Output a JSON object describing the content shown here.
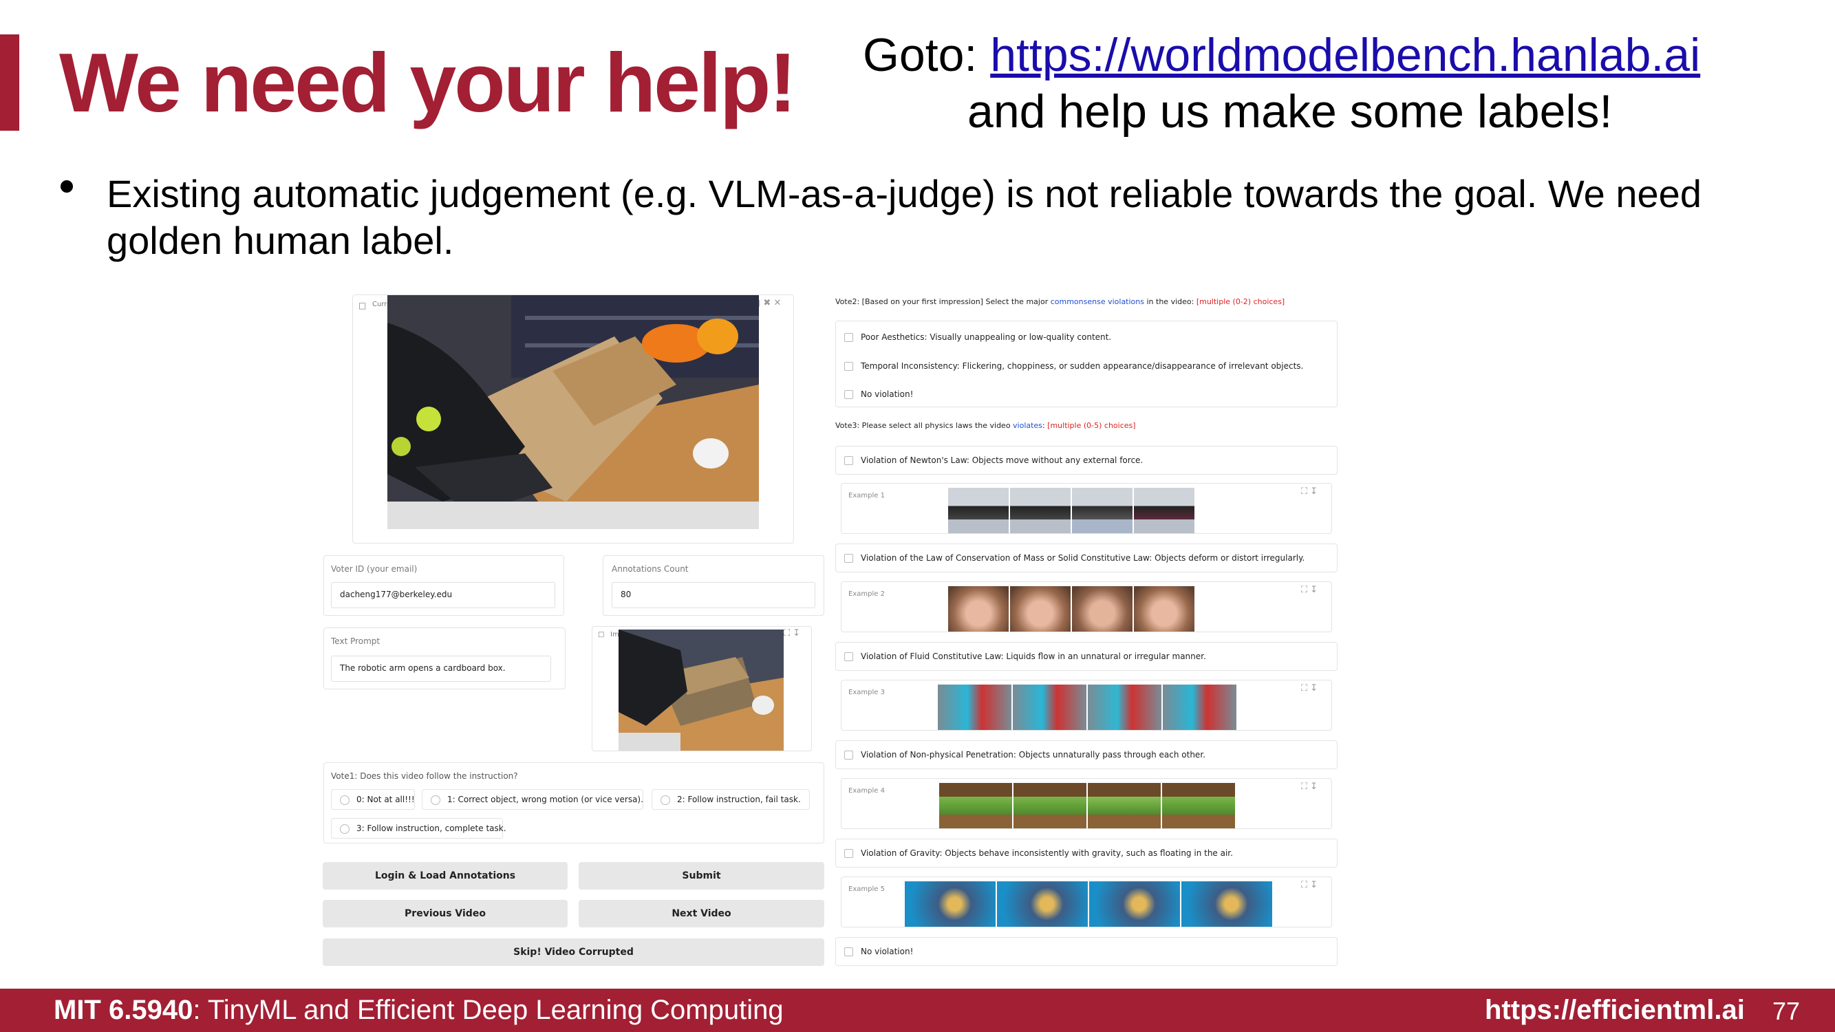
{
  "slide": {
    "title": "We need your help!",
    "goto_prefix": "Goto: ",
    "goto_url": "https://worldmodelbench.hanlab.ai",
    "goto_line2": "and help us make some labels!",
    "bullet": "Existing automatic judgement (e.g. VLM-as-a-judge) is not reliable towards the goal. We need golden human label.",
    "footer_course": "MIT 6.5940",
    "footer_title": ": TinyML and Efficient Deep Learning Computing",
    "footer_url": "https://efficientml.ai",
    "page_number": "77"
  },
  "ui": {
    "current_video_label": "Current Video",
    "voter_id_label": "Voter ID (your email)",
    "voter_id_value": "dacheng177@berkeley.edu",
    "annotations_count_label": "Annotations Count",
    "annotations_count_value": "80",
    "text_prompt_label": "Text Prompt",
    "text_prompt_value": "The robotic arm opens a cardboard box.",
    "image_prompt_label": "Image Prompt",
    "vote1_question": "Vote1: Does this video follow the instruction?",
    "vote1_options": [
      "0: Not at all!!!",
      "1: Correct object, wrong motion (or vice versa).",
      "2: Follow instruction, fail task.",
      "3: Follow instruction, complete task."
    ],
    "buttons": {
      "login": "Login & Load Annotations",
      "submit": "Submit",
      "previous": "Previous Video",
      "next": "Next Video",
      "skip": "Skip! Video Corrupted"
    },
    "vote2": {
      "prefix": "Vote2: [Based on your first impression] Select the major ",
      "highlight": "commonsense violations",
      "middle": " in the video: ",
      "choice": "[multiple (0-2) choices]",
      "options": [
        "Poor Aesthetics: Visually unappealing or low-quality content.",
        "Temporal Inconsistency: Flickering, choppiness, or sudden appearance/disappearance of irrelevant objects.",
        "No violation!"
      ]
    },
    "vote3": {
      "prefix": "Vote3: Please select all physics laws the video ",
      "highlight": "violates",
      "middle": ": ",
      "choice": "[multiple (0-5) choices]",
      "laws": [
        {
          "label": "Violation of Newton's Law: Objects move without any external force.",
          "example": "Example 1"
        },
        {
          "label": "Violation of the Law of Conservation of Mass or Solid Constitutive Law: Objects deform or distort irregularly.",
          "example": "Example 2"
        },
        {
          "label": "Violation of Fluid Constitutive Law: Liquids flow in an unnatural or irregular manner.",
          "example": "Example 3"
        },
        {
          "label": "Violation of Non-physical Penetration: Objects unnaturally pass through each other.",
          "example": "Example 4"
        },
        {
          "label": "Violation of Gravity: Objects behave inconsistently with gravity, such as floating in the air.",
          "example": "Example 5"
        }
      ],
      "no_violation": "No violation!"
    }
  },
  "colors": {
    "accent": "#a31f34",
    "link": "#1a0dab",
    "highlight_blue": "#1f4fd1",
    "highlight_red": "#d22222"
  },
  "icons": [
    "video-icon",
    "image-icon",
    "fullscreen-icon",
    "download-icon",
    "close-icon",
    "share-icon"
  ]
}
